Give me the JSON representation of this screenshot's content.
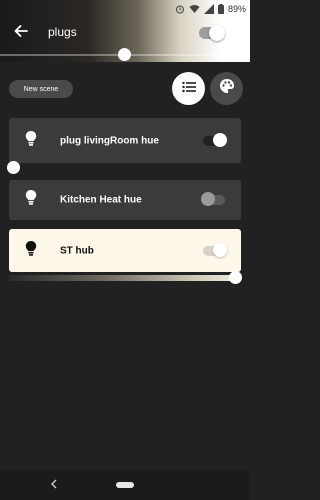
{
  "status_bar": {
    "battery": "89%"
  },
  "header": {
    "title": "plugs",
    "group_on": true,
    "brightness_fraction": 0.5
  },
  "scene": {
    "new_scene_label": "New scene"
  },
  "view_modes": [
    "list",
    "palette"
  ],
  "lights": [
    {
      "name": "plug livingRoom hue",
      "on": true,
      "brightness_fraction": 0.0
    },
    {
      "name": "Kitchen Heat hue",
      "on": false
    },
    {
      "name": "ST hub",
      "on": true,
      "brightness_fraction": 1.0,
      "color": "#fdf8ea"
    }
  ],
  "colors": {
    "background": "#212121",
    "card": "#3b3b3b",
    "active_card": "#fdf8ea",
    "button": "#4a4a4a"
  },
  "icons": [
    "back-arrow-icon",
    "wifi-icon",
    "signal-icon",
    "battery-icon",
    "bulb-icon",
    "list-icon",
    "palette-icon",
    "nav-back-icon",
    "nav-home-icon"
  ]
}
